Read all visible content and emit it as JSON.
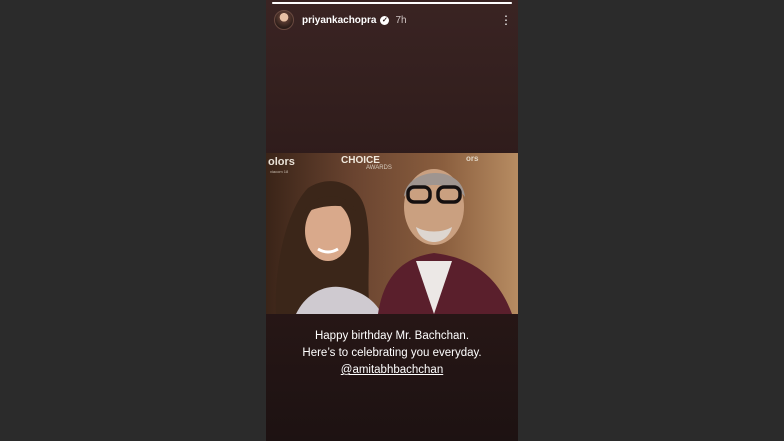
{
  "story": {
    "progress": 1.0,
    "header": {
      "username": "priyankachopra",
      "verified_icon": "verified-badge-icon",
      "timestamp": "7h",
      "more_icon": "more-vertical-icon",
      "more_glyph": "⋮"
    },
    "photo": {
      "backdrop_text_left": "olors",
      "backdrop_text_left_sub": "viacom 18",
      "backdrop_text_center": "CHOICE",
      "backdrop_text_center_sub": "AWARDS",
      "backdrop_text_right": "ors"
    },
    "caption": {
      "line1": "Happy birthday Mr. Bachchan.",
      "line2": "Here’s to celebrating you everyday.",
      "mention": "@amitabhbachchan"
    }
  },
  "colors": {
    "page_background": "#2b2b2b",
    "story_background": "#2c1a19",
    "text": "#ffffff"
  }
}
